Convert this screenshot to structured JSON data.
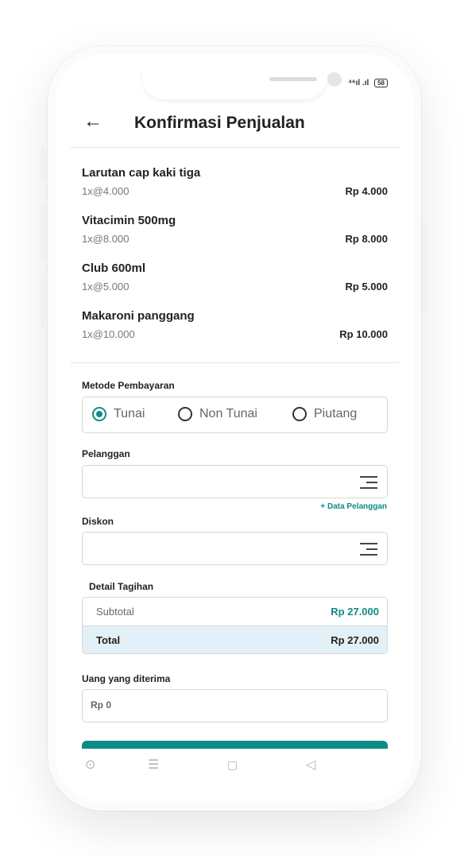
{
  "status": {
    "signal": "⁴⁶ıl .ıl",
    "battery": "58"
  },
  "header": {
    "title": "Konfirmasi Penjualan"
  },
  "items": [
    {
      "name": "Larutan cap kaki tiga",
      "qty": "1x@4.000",
      "price": "Rp 4.000"
    },
    {
      "name": "Vitacimin 500mg",
      "qty": "1x@8.000",
      "price": "Rp 8.000"
    },
    {
      "name": "Club 600ml",
      "qty": "1x@5.000",
      "price": "Rp 5.000"
    },
    {
      "name": "Makaroni panggang",
      "qty": "1x@10.000",
      "price": "Rp 10.000"
    }
  ],
  "payment": {
    "label": "Metode Pembayaran",
    "options": [
      "Tunai",
      "Non Tunai",
      "Piutang"
    ],
    "selected": "Tunai"
  },
  "customer": {
    "label": "Pelanggan",
    "value": "",
    "add_link": "+ Data Pelanggan"
  },
  "discount": {
    "label": "Diskon",
    "value": ""
  },
  "bill": {
    "label": "Detail Tagihan",
    "subtotal_label": "Subtotal",
    "subtotal_value": "Rp 27.000",
    "total_label": "Total",
    "total_value": "Rp 27.000"
  },
  "received": {
    "label": "Uang yang diterima",
    "value": "Rp 0"
  },
  "colors": {
    "accent": "#0f8b85",
    "total_bg": "#e3f0f8"
  },
  "icons": {
    "back": "arrow-left-icon",
    "list": "menu-lines-icon",
    "nav": [
      "circle-icon",
      "menu-icon",
      "home-icon",
      "back-triangle-icon"
    ]
  }
}
